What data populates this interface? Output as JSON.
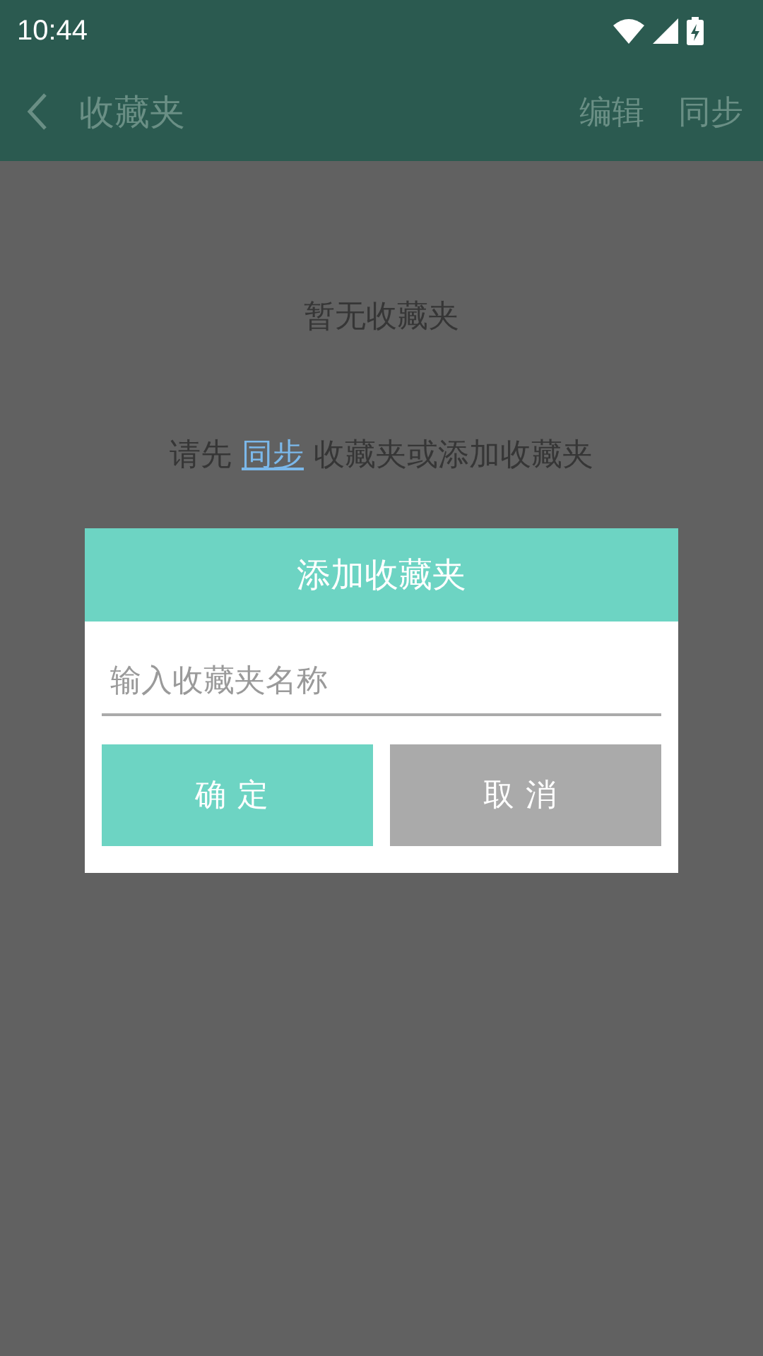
{
  "status_bar": {
    "time": "10:44"
  },
  "app_bar": {
    "title": "收藏夹",
    "actions": [
      "编辑",
      "同步"
    ]
  },
  "empty_state": {
    "title": "暂无收藏夹",
    "message": [
      {
        "kind": "text",
        "text": "请先 "
      },
      {
        "kind": "link",
        "text": "同步"
      },
      {
        "kind": "text",
        "text": " 收藏夹或添加收藏夹"
      }
    ]
  },
  "dialog": {
    "title": "添加收藏夹",
    "input": {
      "placeholder": "输入收藏夹名称"
    },
    "buttons": [
      {
        "label": "确定",
        "kind": "primary"
      },
      {
        "label": "取消",
        "kind": "secondary"
      }
    ]
  }
}
